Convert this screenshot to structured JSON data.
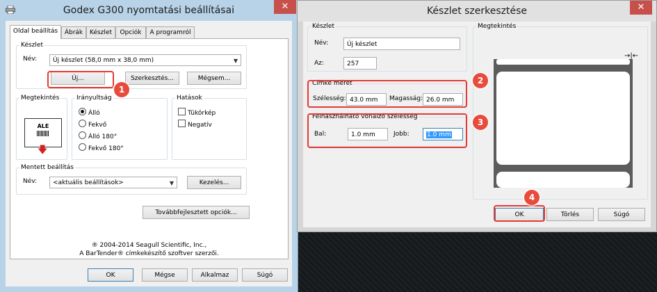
{
  "printer_window": {
    "title": "Godex G300 nyomtatási beállításai",
    "close_label": "✕",
    "tabs": [
      "Oldal beállítás",
      "Ábrák",
      "Készlet",
      "Opciók",
      "A programról"
    ],
    "stock_group": {
      "legend": "Készlet",
      "name_label": "Név:",
      "name_value": "Új készlet (58,0 mm x 38,0 mm)",
      "new_button": "Új...",
      "edit_button": "Szerkesztés...",
      "cancel_button": "Mégsem..."
    },
    "preview_group": {
      "legend": "Megtekintés",
      "card_text": "ALE"
    },
    "orientation_group": {
      "legend": "Irányultság",
      "options": [
        "Álló",
        "Fekvő",
        "Álló 180°",
        "Fekvő 180°"
      ],
      "selected": "Álló"
    },
    "effects_group": {
      "legend": "Hatások",
      "options": [
        "Tükörkép",
        "Negatív"
      ]
    },
    "saved_group": {
      "legend": "Mentett beállítás",
      "name_label": "Név:",
      "name_value": "<aktuális beállítások>",
      "manage_button": "Kezelés..."
    },
    "advanced_button": "Továbbfejlesztett opciók...",
    "copyright_1": "® 2004-2014 Seagull Scientific, Inc.,",
    "copyright_2": "A BarTender® címkekészítő szoftver szerzői.",
    "footer_buttons": [
      "OK",
      "Mégse",
      "Alkalmaz",
      "Súgó"
    ]
  },
  "stock_window": {
    "title": "Készlet szerkesztése",
    "close_label": "✕",
    "stock_group": {
      "legend": "Készlet",
      "name_label": "Név:",
      "name_value": "Új készlet",
      "id_label": "Az:",
      "id_value": "257"
    },
    "label_size_group": {
      "legend": "Címke méret",
      "width_label": "Szélesség:",
      "width_value": "43.0 mm",
      "height_label": "Magasság:",
      "height_value": "26.0 mm"
    },
    "margin_group": {
      "legend": "Felhasználható vonalzó szélesség",
      "left_label": "Bal:",
      "left_value": "1.0 mm",
      "right_label": "Jobb:",
      "right_value": "1.0 mm"
    },
    "preview_legend": "Megtekintés",
    "footer_buttons": [
      "OK",
      "Törlés",
      "Súgó"
    ]
  },
  "callouts": [
    "1",
    "2",
    "3",
    "4"
  ],
  "colors": {
    "highlight": "#e53935",
    "badge": "#e84b3c",
    "close": "#c7504b"
  }
}
